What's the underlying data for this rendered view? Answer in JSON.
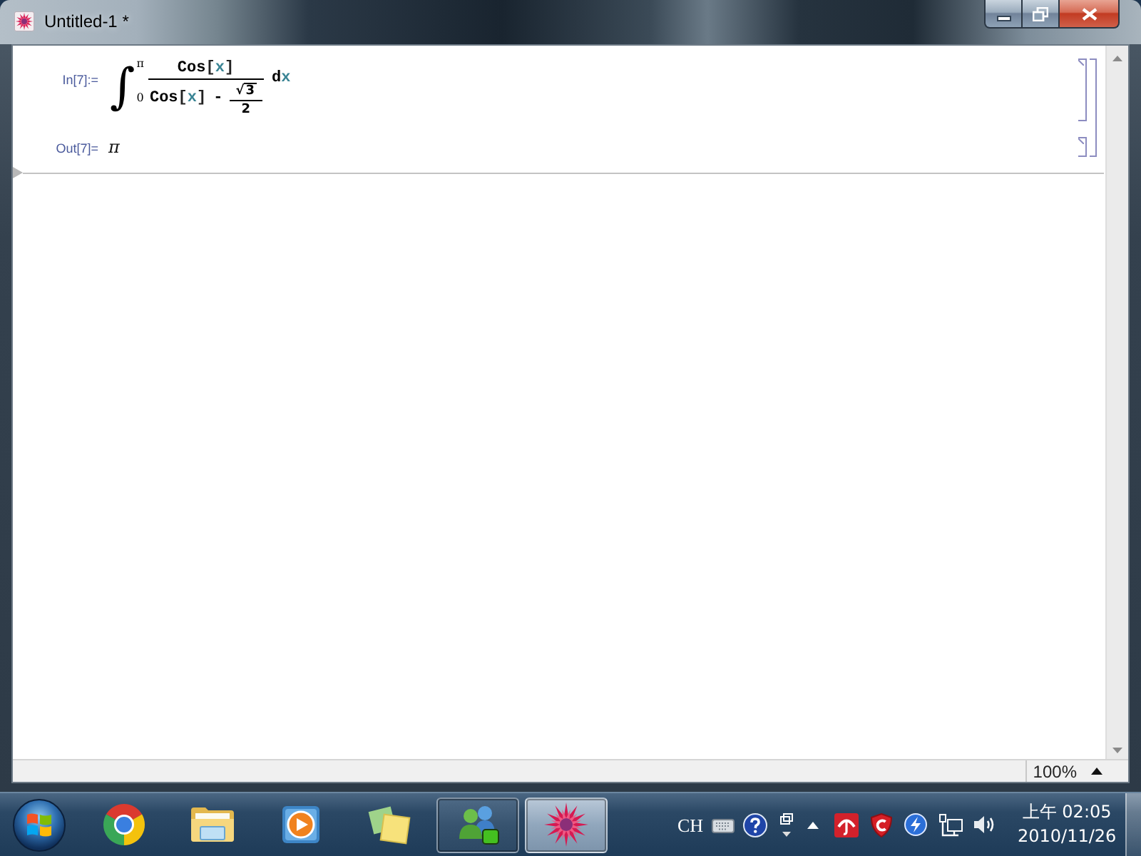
{
  "window": {
    "title": "Untitled-1 *"
  },
  "notebook": {
    "cells": [
      {
        "kind": "input",
        "label": "In[7]:=",
        "integral": {
          "sign": "∫",
          "upper_limit": "π",
          "lower_limit": "0",
          "numerator": [
            {
              "kind": "head",
              "text": "Cos"
            },
            {
              "kind": "bracket",
              "text": "["
            },
            {
              "kind": "variable",
              "text": "x"
            },
            {
              "kind": "bracket",
              "text": "]"
            }
          ],
          "denominator": [
            {
              "kind": "head",
              "text": "Cos"
            },
            {
              "kind": "bracket",
              "text": "["
            },
            {
              "kind": "variable",
              "text": "x"
            },
            {
              "kind": "bracket",
              "text": "]"
            }
          ],
          "operator": "-",
          "radical": "√",
          "radicand": "3",
          "divisor": "2",
          "differential": [
            {
              "kind": "head",
              "text": "d"
            },
            {
              "kind": "variable",
              "text": "x"
            }
          ]
        }
      },
      {
        "kind": "output",
        "label": "Out[7]=",
        "value": "π"
      }
    ]
  },
  "status_bar": {
    "zoom": "100%"
  },
  "taskbar": {
    "apps": [
      {
        "running": false,
        "selected": false
      },
      {
        "running": false,
        "selected": false
      },
      {
        "running": false,
        "selected": false
      },
      {
        "running": false,
        "selected": false
      },
      {
        "running": true,
        "selected": false
      },
      {
        "running": true,
        "selected": true
      }
    ],
    "tray": {
      "language": "CH",
      "time": "上午 02:05",
      "date": "2010/11/26"
    }
  }
}
